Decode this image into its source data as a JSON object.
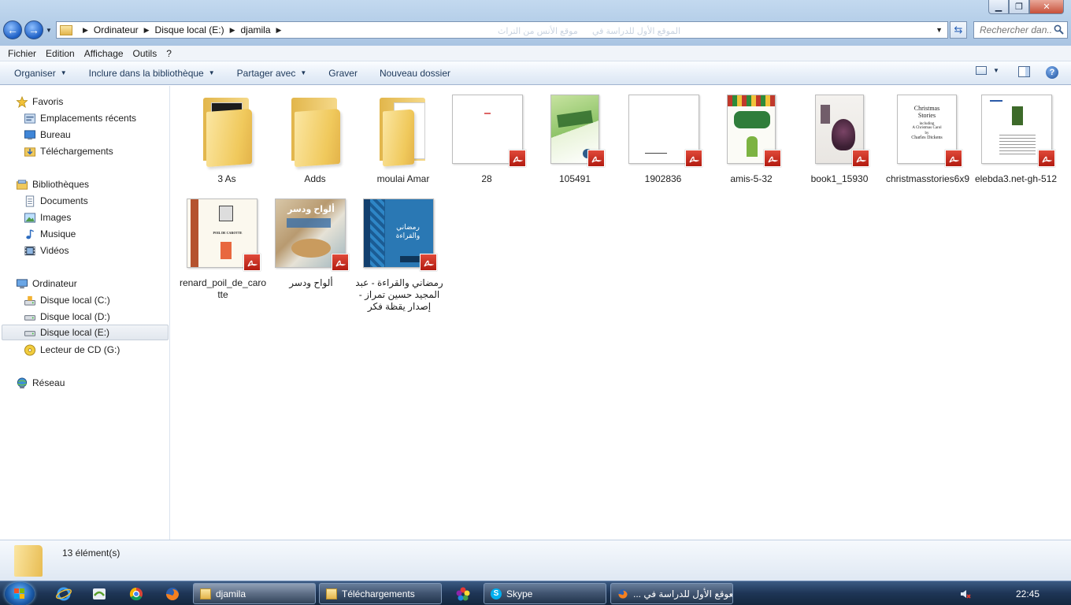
{
  "window": {
    "minimize": "▁",
    "maximize": "❐",
    "close": "✕"
  },
  "address": {
    "crumbs": [
      "Ordinateur",
      "Disque local (E:)",
      "djamila"
    ],
    "ghost_tab_1": "موقع الأنس من التراث",
    "ghost_tab_2": "الموقع الأول للدراسة في"
  },
  "search": {
    "placeholder": "Rechercher dan..."
  },
  "menu": [
    "Fichier",
    "Edition",
    "Affichage",
    "Outils",
    "?"
  ],
  "commands": {
    "organize": "Organiser",
    "include_library": "Inclure dans la bibliothèque",
    "share_with": "Partager avec",
    "burn": "Graver",
    "new_folder": "Nouveau dossier"
  },
  "nav": {
    "favorites": "Favoris",
    "recent_places": "Emplacements récents",
    "desktop": "Bureau",
    "downloads": "Téléchargements",
    "libraries": "Bibliothèques",
    "documents": "Documents",
    "images": "Images",
    "music": "Musique",
    "videos": "Vidéos",
    "computer": "Ordinateur",
    "drive_c": "Disque local (C:)",
    "drive_d": "Disque local (D:)",
    "drive_e": "Disque local (E:)",
    "cd_drive": "Lecteur de CD (G:)",
    "network": "Réseau"
  },
  "files": [
    {
      "name": "3 As",
      "kind": "folder"
    },
    {
      "name": "Adds",
      "kind": "folder"
    },
    {
      "name": "moulai Amar",
      "kind": "folder"
    },
    {
      "name": "28",
      "kind": "pdf"
    },
    {
      "name": "105491",
      "kind": "pdf"
    },
    {
      "name": "1902836",
      "kind": "pdf"
    },
    {
      "name": "amis-5-32",
      "kind": "pdf"
    },
    {
      "name": "book1_15930",
      "kind": "pdf"
    },
    {
      "name": "christmasstories6x9",
      "kind": "pdf",
      "cover": [
        "Christmas",
        "Stories",
        "including",
        "A Christmas Carol",
        "by",
        "Charles Dickens"
      ]
    },
    {
      "name": "elebda3.net-gh-512",
      "kind": "pdf"
    },
    {
      "name": "renard_poil_de_carotte",
      "kind": "pdf",
      "cover": [
        "POIL DE CAROTTE"
      ]
    },
    {
      "name": "ألواح ودسر",
      "kind": "pdf",
      "cover": [
        "ألواح ودسر"
      ]
    },
    {
      "name": "رمضاني والقراءة - عبد المجيد حسين تمراز - إصدار يقظة فكر",
      "kind": "pdf",
      "cover": [
        "رمضاني والقراءة"
      ]
    }
  ],
  "status": {
    "count": "13 élément(s)"
  },
  "taskbar": {
    "tasks": [
      "djamila",
      "Téléchargements",
      "Skype",
      "العوقع الأول للدراسة في ..."
    ],
    "clock": "22:45"
  },
  "colors": {
    "accent": "#1d5fc5",
    "pdf_red": "#c8281c",
    "folder_yellow": "#f0c95c"
  }
}
